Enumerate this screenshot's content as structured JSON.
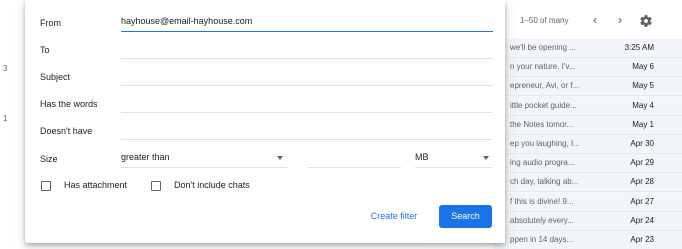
{
  "background": {
    "left_numbers": [
      "3",
      "1"
    ],
    "inbox": {
      "count": "1–50 of many",
      "rows": [
        {
          "snippet": "we'll be opening ...",
          "date": "3:25 AM"
        },
        {
          "snippet": "n your nature. I'v...",
          "date": "May 6"
        },
        {
          "snippet": "epreneur, Avi, or f...",
          "date": "May 5"
        },
        {
          "snippet": "ittle pocket guide...",
          "date": "May 4"
        },
        {
          "snippet": "the Notes tomor...",
          "date": "May 1"
        },
        {
          "snippet": "ep you laughing, I...",
          "date": "Apr 30"
        },
        {
          "snippet": "ing audio progra...",
          "date": "Apr 29"
        },
        {
          "snippet": "ch day, talking ab...",
          "date": "Apr 28"
        },
        {
          "snippet": "f this is divine! 9...",
          "date": "Apr 27"
        },
        {
          "snippet": "absolutely every...",
          "date": "Apr 24"
        },
        {
          "snippet": "ppen in 14 days...",
          "date": "Apr 23"
        }
      ]
    }
  },
  "filter": {
    "from_label": "From",
    "from_value": "hayhouse@email-hayhouse.com",
    "to_label": "To",
    "subject_label": "Subject",
    "has_words_label": "Has the words",
    "doesnt_have_label": "Doesn't have",
    "size_label": "Size",
    "size_operator": "greater than",
    "size_unit": "MB",
    "has_attachment_label": "Has attachment",
    "dont_include_chats_label": "Don't include chats",
    "create_filter_label": "Create filter",
    "search_label": "Search"
  },
  "colors": {
    "accent": "#1a73e8"
  }
}
